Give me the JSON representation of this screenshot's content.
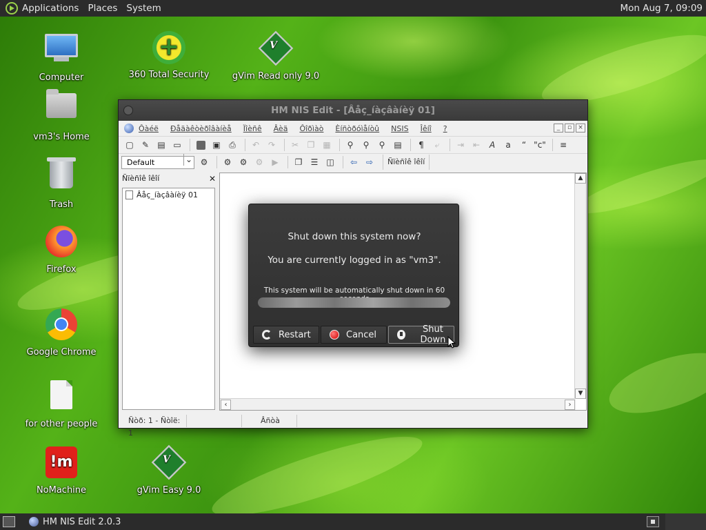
{
  "top_panel": {
    "menus": [
      "Applications",
      "Places",
      "System"
    ],
    "clock": "Mon Aug  7, 09:09"
  },
  "desktop_icons": [
    {
      "label": "Computer",
      "icon": "computer-icon"
    },
    {
      "label": "vm3's Home",
      "icon": "home-folder-icon"
    },
    {
      "label": "Trash",
      "icon": "trash-icon"
    },
    {
      "label": "Firefox",
      "icon": "firefox-icon"
    },
    {
      "label": "Google Chrome",
      "icon": "chrome-icon"
    },
    {
      "label": "for other people",
      "icon": "file-icon"
    },
    {
      "label": "NoMachine",
      "icon": "nomachine-icon"
    },
    {
      "label": "360 Total Security",
      "icon": "total-security-icon"
    },
    {
      "label": "gVim Read only 9.0",
      "icon": "gvim-icon"
    },
    {
      "label": "gVim Easy 9.0",
      "icon": "gvim-icon"
    }
  ],
  "window": {
    "title": "HM NIS Edit - [Âåç_íàçâàíèÿ 01]",
    "menu": [
      "Ôàéë",
      "Ðåäàêòèðîâàíèå",
      "Ïîèñê",
      "Âèä",
      "Ôîðìàò",
      "Èíñòðóìåíòû",
      "NSIS",
      "Îêíî",
      "?"
    ],
    "combo_value": "Default",
    "toolbar2_tab": "Ñïèñîê îêîí",
    "panel_title": "Ñïèñîê îêîí",
    "panel_item": "Âåç_íàçâàíèÿ 01",
    "status_pos": "Ñòð: 1 - Ñòîë: 1",
    "status_mode": "Âñòà",
    "mdi_min": "_",
    "mdi_restore": "▫",
    "mdi_close": "×"
  },
  "dialog": {
    "question": "Shut down this system now?",
    "user_line": "You are currently logged in as \"vm3\".",
    "timer": "This system will be automatically shut down in 60 seconds",
    "progress": 1.0,
    "buttons": {
      "restart": "Restart",
      "cancel": "Cancel",
      "shutdown": "Shut Down"
    }
  },
  "bottom_panel": {
    "task": "HM NIS Edit 2.0.3"
  }
}
